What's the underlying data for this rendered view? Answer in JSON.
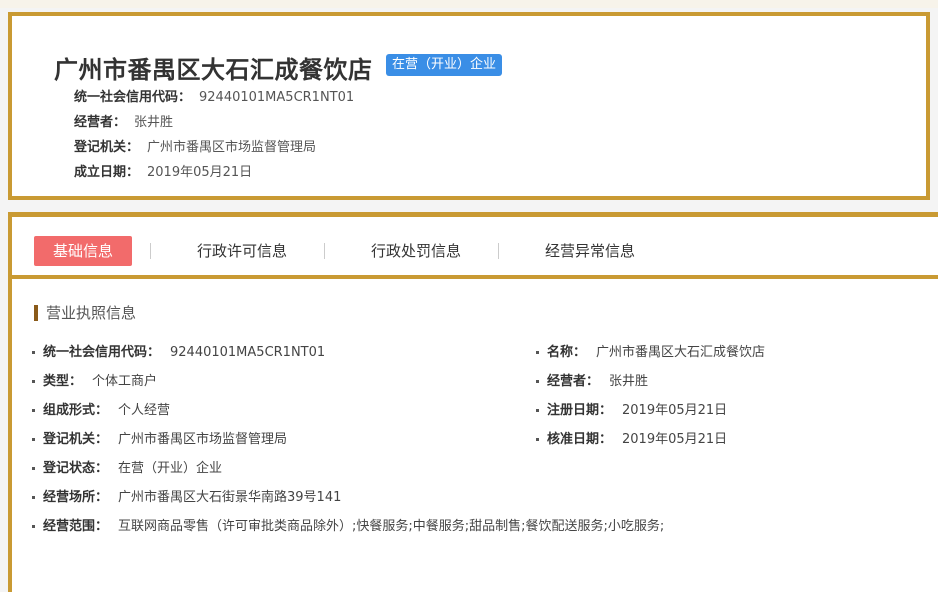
{
  "header": {
    "company_name": "广州市番禺区大石汇成餐饮店",
    "status_badge": "在营（开业）企业",
    "rows": [
      {
        "label": "统一社会信用代码：",
        "value": "92440101MA5CR1NT01"
      },
      {
        "label": "经营者：",
        "value": "张井胜"
      },
      {
        "label": "登记机关：",
        "value": "广州市番禺区市场监督管理局"
      },
      {
        "label": "成立日期：",
        "value": "2019年05月21日"
      }
    ]
  },
  "tabs": [
    "基础信息",
    "行政许可信息",
    "行政处罚信息",
    "经营异常信息"
  ],
  "section_title": "营业执照信息",
  "left_fields": [
    {
      "label": "统一社会信用代码：",
      "value": "92440101MA5CR1NT01"
    },
    {
      "label": "类型：",
      "value": "个体工商户"
    },
    {
      "label": "组成形式：",
      "value": "个人经营"
    },
    {
      "label": "登记机关：",
      "value": "广州市番禺区市场监督管理局"
    },
    {
      "label": "登记状态：",
      "value": "在营（开业）企业"
    },
    {
      "label": "经营场所：",
      "value": "广州市番禺区大石街景华南路39号141"
    },
    {
      "label": "经营范围：",
      "value": "互联网商品零售（许可审批类商品除外）;快餐服务;中餐服务;甜品制售;餐饮配送服务;小吃服务;"
    }
  ],
  "right_fields": [
    {
      "label": "名称：",
      "value": "广州市番禺区大石汇成餐饮店"
    },
    {
      "label": "经营者：",
      "value": "张井胜"
    },
    {
      "label": "注册日期：",
      "value": "2019年05月21日"
    },
    {
      "label": "核准日期：",
      "value": "2019年05月21日"
    }
  ],
  "colors": {
    "accent": "#c99a33",
    "active_tab": "#f26b6b",
    "badge": "#3a8ee6"
  }
}
